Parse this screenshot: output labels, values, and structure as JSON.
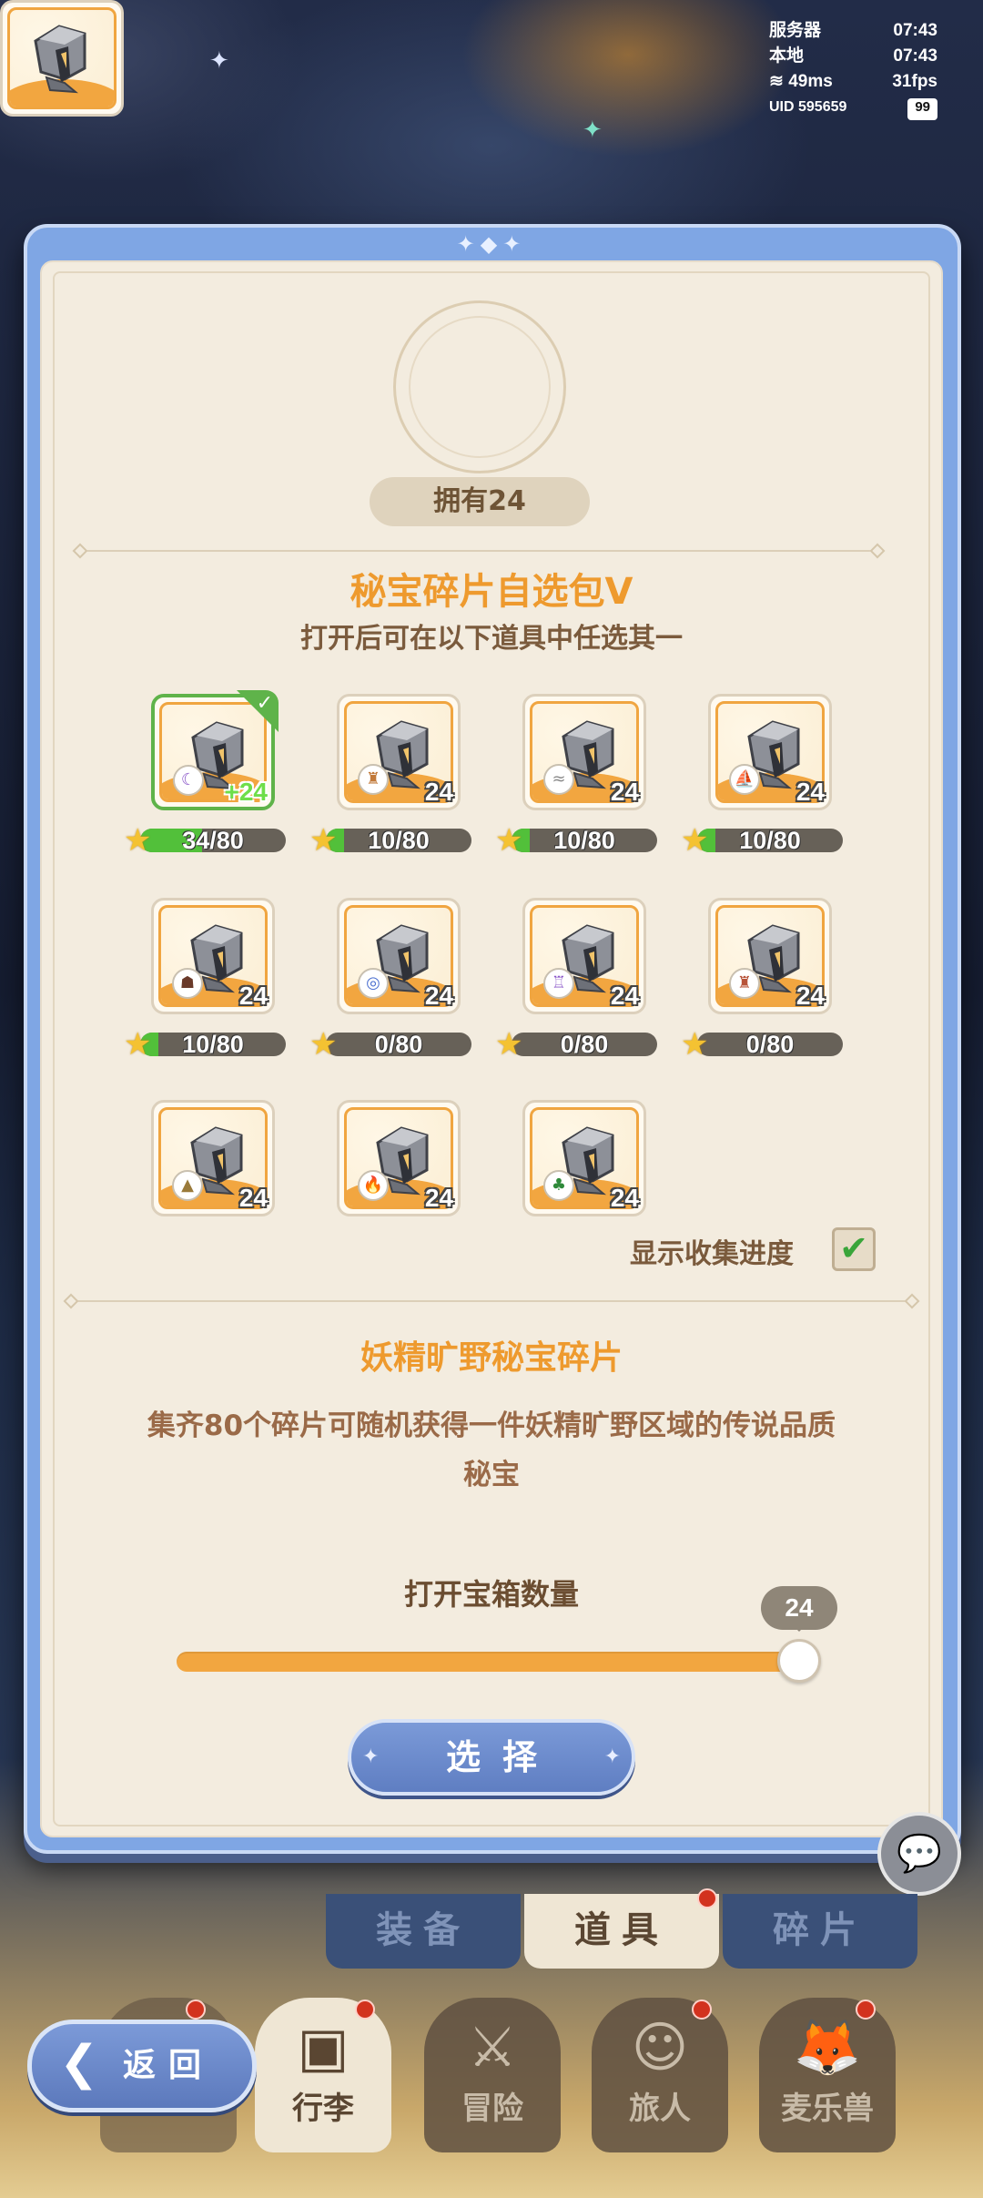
{
  "status": {
    "server_label": "服务器",
    "server_time": "07:43",
    "local_label": "本地",
    "local_time": "07:43",
    "ping": "49ms",
    "fps": "31fps",
    "uid": "UID 595659",
    "battery": "99"
  },
  "dialog": {
    "owned_text": "拥有24",
    "title": "秘宝碎片自选包V",
    "subtitle": "打开后可在以下道具中任选其一",
    "items": [
      {
        "count": "+24",
        "progress": "34/80",
        "progress_value": 0.425,
        "icon": "moon-swirl-icon",
        "selected": true
      },
      {
        "count": "24",
        "progress": "10/80",
        "progress_value": 0.125,
        "icon": "castle-icon"
      },
      {
        "count": "24",
        "progress": "10/80",
        "progress_value": 0.125,
        "icon": "water-wave-icon"
      },
      {
        "count": "24",
        "progress": "10/80",
        "progress_value": 0.125,
        "icon": "sailboat-icon"
      },
      {
        "count": "24",
        "progress": "10/80",
        "progress_value": 0.125,
        "icon": "golem-icon"
      },
      {
        "count": "24",
        "progress": "0/80",
        "progress_value": 0,
        "icon": "vortex-icon"
      },
      {
        "count": "24",
        "progress": "0/80",
        "progress_value": 0,
        "icon": "palace-icon"
      },
      {
        "count": "24",
        "progress": "0/80",
        "progress_value": 0,
        "icon": "tower-icon"
      },
      {
        "count": "24",
        "icon": "mountain-icon"
      },
      {
        "count": "24",
        "icon": "flame-icon"
      },
      {
        "count": "24",
        "icon": "pine-tree-icon"
      }
    ],
    "show_progress_label": "显示收集进度",
    "show_progress_checked": true,
    "detail_title": "妖精旷野秘宝碎片",
    "detail_desc_line1": "集齐80个碎片可随机获得一件妖精旷野区域的传说品质",
    "detail_desc_line2": "秘宝",
    "qty_label": "打开宝箱数量",
    "qty_value": "24",
    "select_label": "选择"
  },
  "tabs": [
    {
      "label": "装备"
    },
    {
      "label": "道具",
      "active": true
    },
    {
      "label": "碎片"
    }
  ],
  "nav": [
    {
      "label": "行李",
      "active": true
    },
    {
      "label": "冒险"
    },
    {
      "label": "旅人"
    },
    {
      "label": "麦乐兽"
    }
  ],
  "back_label": "返回",
  "colors": {
    "accent": "#f2a640",
    "title": "#ee9a2e",
    "button_blue": "#6b8acb",
    "progress_green": "#52c03a"
  }
}
